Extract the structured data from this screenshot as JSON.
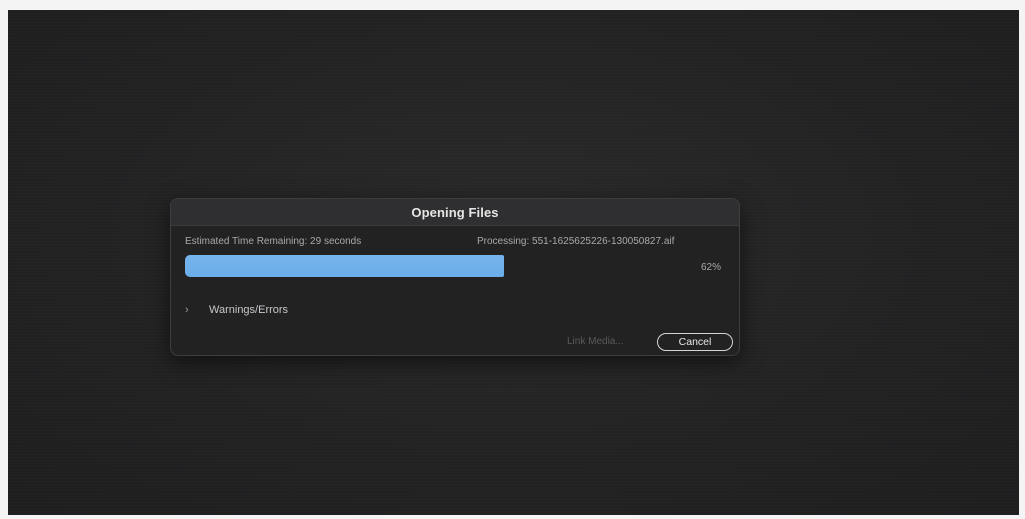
{
  "dialog": {
    "title": "Opening Files",
    "eta_text": "Estimated Time Remaining: 29 seconds",
    "processing_text": "Processing: 551-1625625226-130050827.aif",
    "progress": {
      "value_percent": 62,
      "label": "62%",
      "fill_color": "#6aadea"
    },
    "warnings_label": "Warnings/Errors",
    "link_media_label": "Link Media...",
    "cancel_label": "Cancel"
  }
}
